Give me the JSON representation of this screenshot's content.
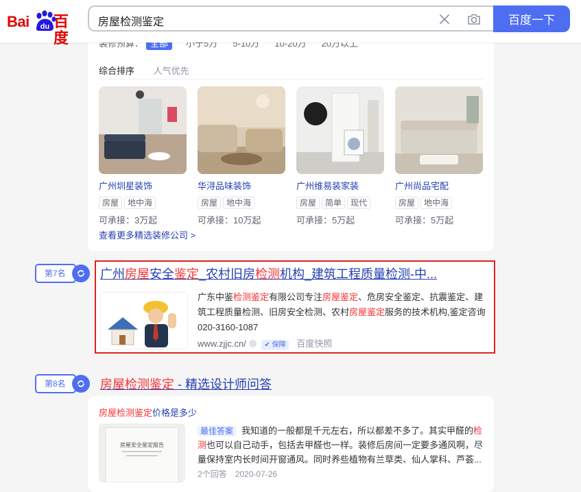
{
  "header": {
    "logo_bai": "Bai",
    "logo_du": "du",
    "logo_cn": "百度",
    "search_query": "房屋检测鉴定",
    "search_button": "百度一下",
    "clear_icon": "close-icon",
    "camera_icon": "camera-icon"
  },
  "decor_card": {
    "filter_label": "装修预算：",
    "filters": [
      "全部",
      "小于5万",
      "5-10万",
      "10-20万",
      "20万以上"
    ],
    "tabs": [
      "综合排序",
      "人气优先"
    ],
    "companies": [
      {
        "name": "广州圳星装饰",
        "tags": [
          "房屋",
          "地中海"
        ],
        "price": "可承接：3万起"
      },
      {
        "name": "华浔品味装饰",
        "tags": [
          "房屋",
          "地中海"
        ],
        "price": "可承接：10万起"
      },
      {
        "name": "广州维易装家装",
        "tags": [
          "房屋",
          "简单",
          "现代"
        ],
        "price": "可承接：5万起"
      },
      {
        "name": "广州尚品宅配",
        "tags": [
          "房屋",
          "地中海"
        ],
        "price": "可承接：5万起"
      }
    ],
    "more_link": "查看更多精选装修公司 >"
  },
  "result7": {
    "rank": "第7名",
    "title_parts": [
      "广州",
      "房屋",
      "安全",
      "鉴定",
      "_农村旧房",
      "检测",
      "机构_建筑工程质量检测-中..."
    ],
    "desc_parts": [
      "广东中鉴",
      "检测鉴定",
      "有限公司专注",
      "房屋鉴定",
      "、危房安全鉴定、抗震鉴定、建筑工程质量检测、旧房安全检测、农村",
      "房屋鉴定",
      "服务的技术机构,鉴定咨询020-3160-1087"
    ],
    "url": "www.zjjc.cn/",
    "verify": "保障",
    "snapshot": "百度快照"
  },
  "result8": {
    "rank": "第8名",
    "title_hl": "房屋检测鉴定",
    "title_rest": " - 精选设计师问答",
    "question_hl": "房屋检测鉴定",
    "question_rest": "价格是多少",
    "best_answer_tag": "最佳答案",
    "answer_parts": [
      "我知道的一般都是千元左右，所以都差不多了。其实甲醛的",
      "检测",
      "也可以自己动手，包括去甲醛也一样。装修后房间一定要多通风啊，尽量保持室内长时间开窗通风。同时养些植物有兰草类、仙人掌科、芦荟..."
    ],
    "answer_count": "2个回答",
    "date": "2020-07-26",
    "report_title": "房屋安全鉴定报告"
  }
}
